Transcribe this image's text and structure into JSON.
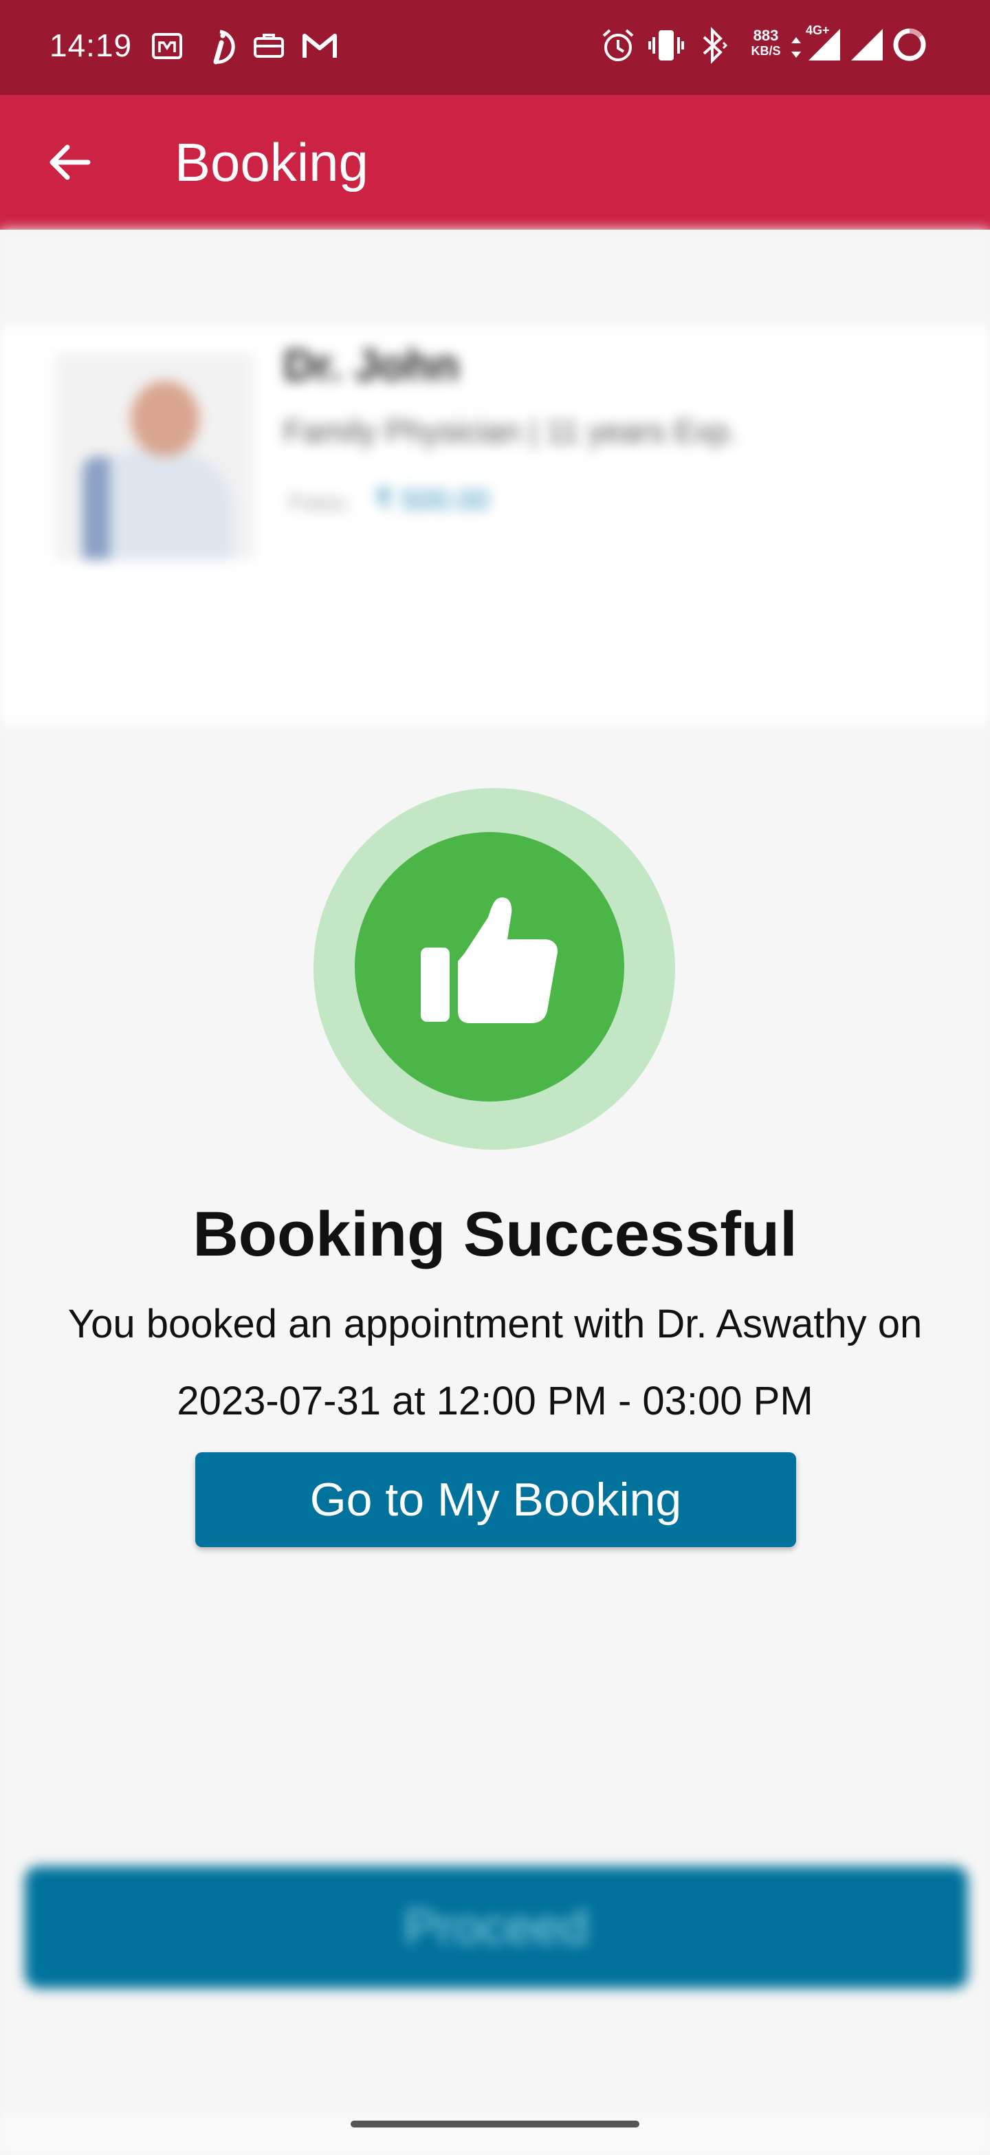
{
  "status_bar": {
    "time": "14:19",
    "speed_value": "883",
    "speed_unit": "KB/S",
    "network": "4G+",
    "icons": [
      "m-app-icon",
      "italic-i-app-icon",
      "briefcase-icon",
      "gmail-icon",
      "alarm-icon",
      "vibrate-icon",
      "bluetooth-icon",
      "signal-icon",
      "signal-icon",
      "battery-ring-icon"
    ]
  },
  "app_bar": {
    "title": "Booking",
    "back_icon": "arrow-left-icon"
  },
  "background": {
    "doctor_name": "Dr. John",
    "doctor_specialty": "Family Physician | 11 years Exp.",
    "fee_label": "Fees:",
    "fee_value": "₹ 500.00",
    "proceed_label": "Proceed"
  },
  "success": {
    "icon": "thumbs-up-icon",
    "title": "Booking Successful",
    "message": "You booked an appointment with Dr. Aswathy on 2023-07-31 at 12:00 PM - 03:00 PM",
    "button_label": "Go to My Booking"
  },
  "colors": {
    "status_bar": "#9b1831",
    "app_bar": "#cc2244",
    "success_green": "#4bb548",
    "success_ring": "#c3e6c5",
    "primary_button": "#00729b"
  }
}
